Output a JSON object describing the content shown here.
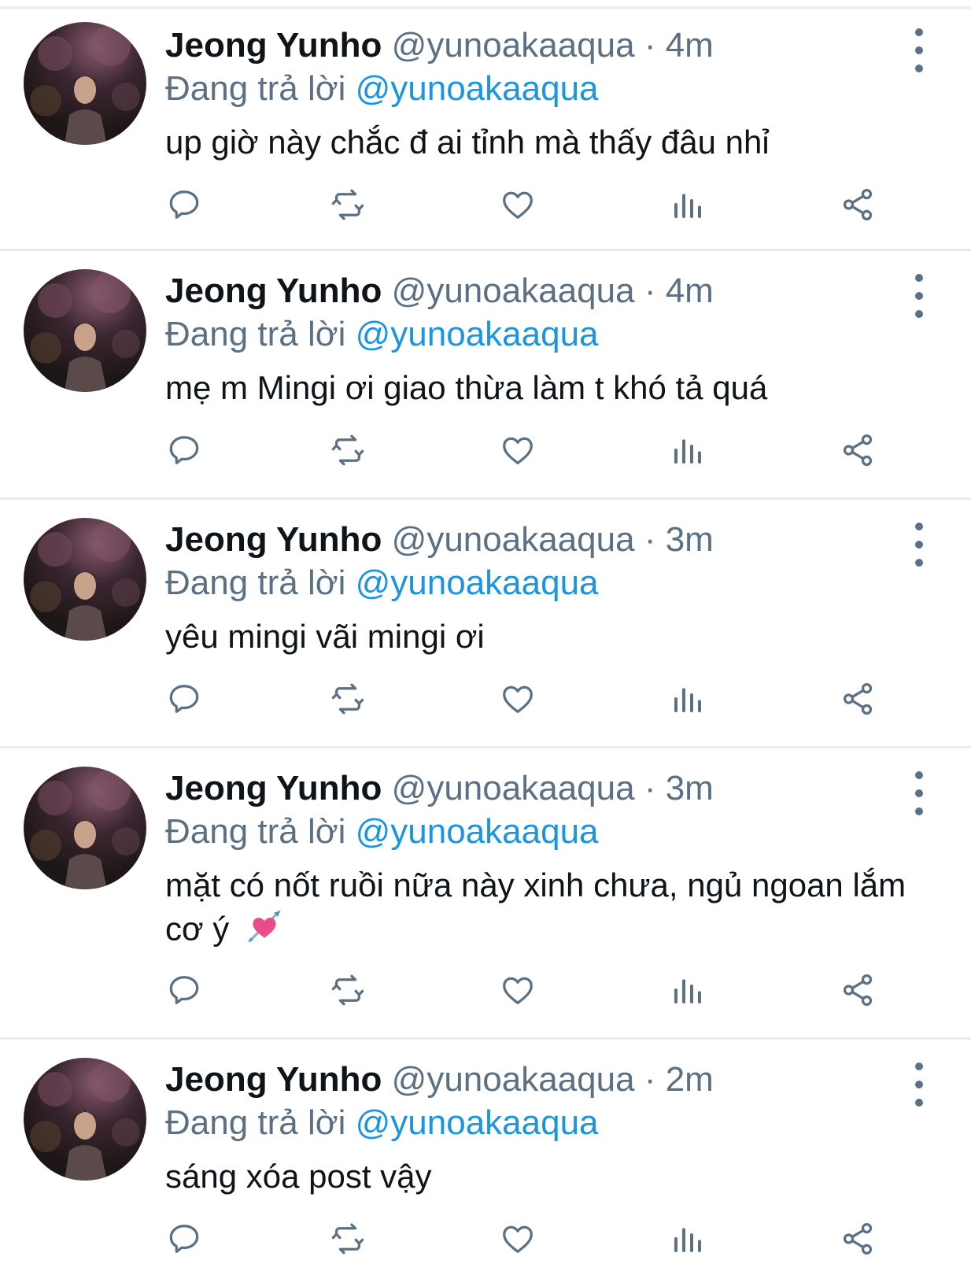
{
  "tweets": [
    {
      "author": "Jeong Yunho",
      "handle": "@yunoakaaqua",
      "separator": "·",
      "time": "4m",
      "reply_prefix": "Đang trả lời",
      "reply_to": "@yunoakaaqua",
      "text": "up giờ này chắc đ ai tỉnh mà thấy đâu nhỉ"
    },
    {
      "author": "Jeong Yunho",
      "handle": "@yunoakaaqua",
      "separator": "·",
      "time": "4m",
      "reply_prefix": "Đang trả lời",
      "reply_to": "@yunoakaaqua",
      "text": "mẹ m Mingi ơi giao thừa làm t khó tả quá"
    },
    {
      "author": "Jeong Yunho",
      "handle": "@yunoakaaqua",
      "separator": "·",
      "time": "3m",
      "reply_prefix": "Đang trả lời",
      "reply_to": "@yunoakaaqua",
      "text": "yêu mingi vãi mingi ơi"
    },
    {
      "author": "Jeong Yunho",
      "handle": "@yunoakaaqua",
      "separator": "·",
      "time": "3m",
      "reply_prefix": "Đang trả lời",
      "reply_to": "@yunoakaaqua",
      "text": "mặt có nốt ruồi nữa này xinh chưa, ngủ ngoan lắm cơ ý",
      "emoji": "heart-with-arrow"
    },
    {
      "author": "Jeong Yunho",
      "handle": "@yunoakaaqua",
      "separator": "·",
      "time": "2m",
      "reply_prefix": "Đang trả lời",
      "reply_to": "@yunoakaaqua",
      "text": "sáng xóa post vậy"
    }
  ],
  "action_icons": [
    "reply-icon",
    "retweet-icon",
    "like-icon",
    "analytics-icon",
    "share-icon"
  ],
  "colors": {
    "text": "#0f1419",
    "secondary": "#5b7083",
    "link": "#1b95e0",
    "divider": "#e6ecf0"
  }
}
